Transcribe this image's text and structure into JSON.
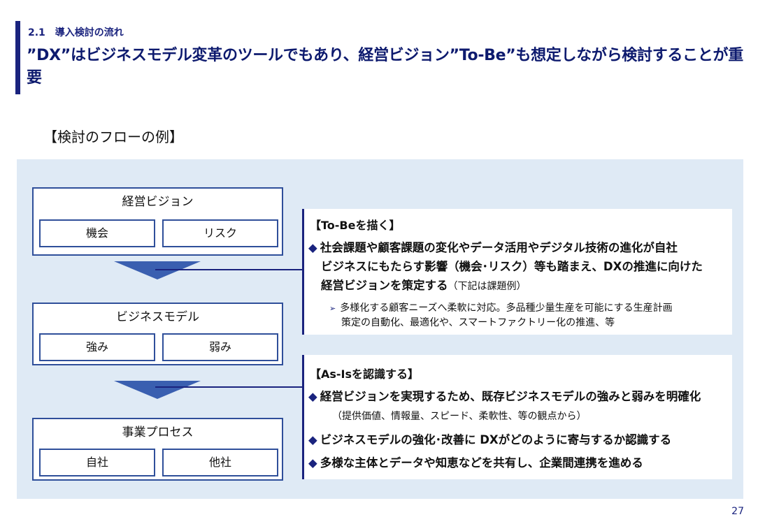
{
  "header": {
    "section_label": "2.1　導入検討の流れ",
    "title": "”DX”はビジネスモデル変革のツールでもあり、経営ビジョン”To-Be”も想定しながら検討することが重要"
  },
  "subtitle": "【検討のフローの例】",
  "flow": {
    "vision": {
      "title": "経営ビジョン",
      "left": "機会",
      "right": "リスク"
    },
    "business_model": {
      "title": "ビジネスモデル",
      "left": "強み",
      "right": "弱み"
    },
    "process": {
      "title": "事業プロセス",
      "left": "自社",
      "right": "他社"
    }
  },
  "tobe": {
    "heading": "【To-Beを描く】",
    "bullet1_line1": "社会課題や顧客課題の変化やデータ活用やデジタル技術の進化が自社",
    "bullet1_line2": "ビジネスにもたらす影響（機会･リスク）等も踏まえ、DXの推進に向けた",
    "bullet1_line3": "経営ビジョンを策定する",
    "bullet1_note": "（下記は課題例）",
    "sub_line1": "多様化する顧客ニーズへ柔軟に対応。多品種少量生産を可能にする生産計画",
    "sub_line2": "策定の自動化、最適化や、スマートファクトリー化の推進、等"
  },
  "asis": {
    "heading": "【As-Isを認識する】",
    "bullet1": "経営ビジョンを実現するため、既存ビジネスモデルの強みと弱みを明確化",
    "bullet1_note": "（提供価値、情報量、スピード、柔軟性、等の観点から）",
    "bullet2": "ビジネスモデルの強化･改善に DXがどのように寄与するか認識する",
    "bullet3": "多様な主体とデータや知恵などを共有し、企業間連携を進める"
  },
  "page_number": "27"
}
